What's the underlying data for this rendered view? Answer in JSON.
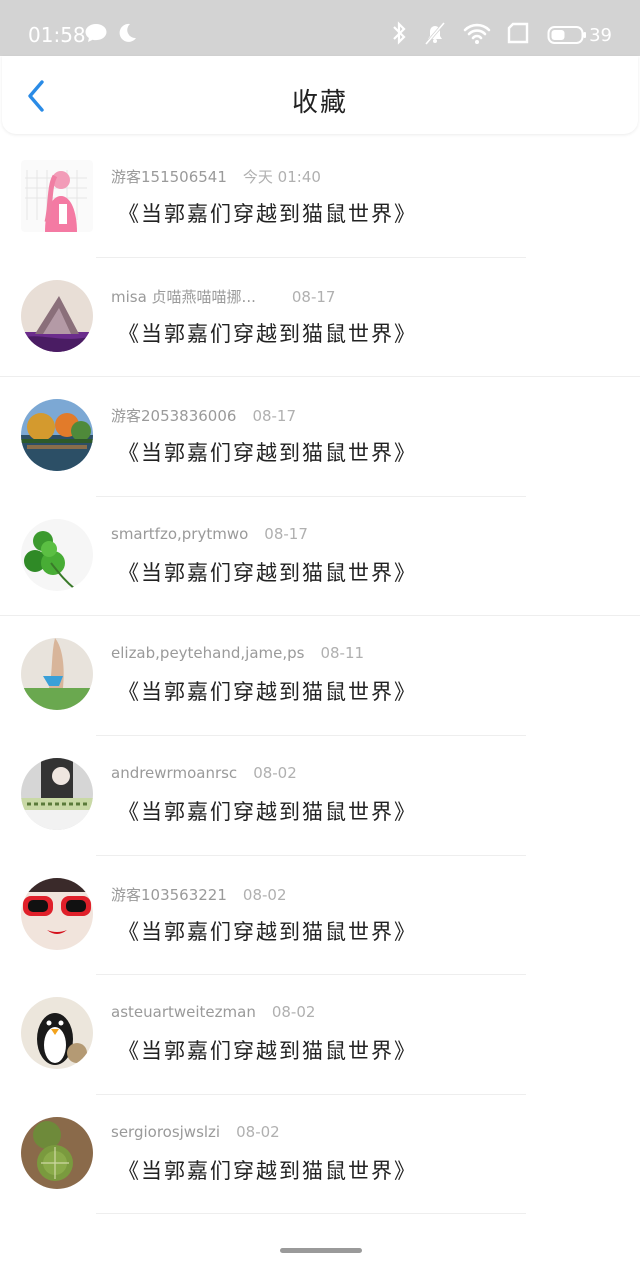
{
  "status_bar": {
    "time": "01:58",
    "battery_level": "39",
    "icons": [
      "chat-bubble-icon",
      "moon-icon",
      "bluetooth-icon",
      "bell-off-icon",
      "wifi-icon",
      "sim-icon",
      "battery-icon"
    ]
  },
  "header": {
    "title": "收藏",
    "back_icon": "chevron-left-icon",
    "accent_color": "#2a8be6"
  },
  "favorites": [
    {
      "user": "游客151506541",
      "date": "今天 01:40",
      "title": "《当郭嘉们穿越到猫鼠世界》"
    },
    {
      "user": "misa 贞喵燕喵喵挪...",
      "date": "08-17",
      "title": "《当郭嘉们穿越到猫鼠世界》"
    },
    {
      "user": "游客2053836006",
      "date": "08-17",
      "title": "《当郭嘉们穿越到猫鼠世界》"
    },
    {
      "user": "smartfzo,prytmwo",
      "date": "08-17",
      "title": "《当郭嘉们穿越到猫鼠世界》"
    },
    {
      "user": "elizab,peytehand,jame,ps",
      "date": "08-11",
      "title": "《当郭嘉们穿越到猫鼠世界》"
    },
    {
      "user": "andrewrmoanrsc",
      "date": "08-02",
      "title": "《当郭嘉们穿越到猫鼠世界》"
    },
    {
      "user": "游客103563221",
      "date": "08-02",
      "title": "《当郭嘉们穿越到猫鼠世界》"
    },
    {
      "user": "asteuartweitezman",
      "date": "08-02",
      "title": "《当郭嘉们穿越到猫鼠世界》"
    },
    {
      "user": "sergiorosjwslzi",
      "date": "08-02",
      "title": "《当郭嘉们穿越到猫鼠世界》"
    }
  ]
}
